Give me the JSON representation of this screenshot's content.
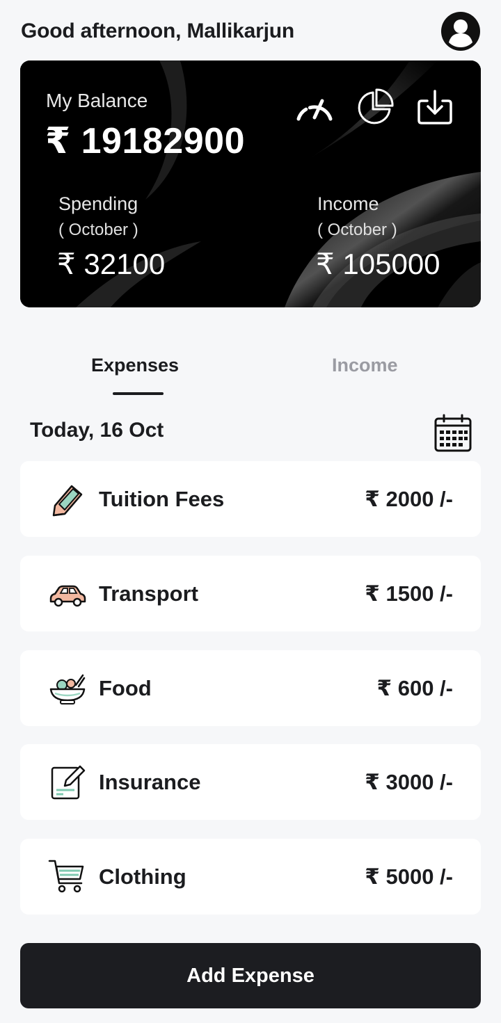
{
  "header": {
    "greeting": "Good afternoon, Mallikarjun",
    "avatar_icon": "user-avatar-icon"
  },
  "balance_card": {
    "balance_label": "My Balance",
    "balance_value": "₹ 19182900",
    "spending_label": "Spending",
    "spending_period": "( October )",
    "spending_value": "₹ 32100",
    "income_label": "Income",
    "income_period": "( October )",
    "income_value": "₹ 105000",
    "action_icons": [
      "speedometer-icon",
      "pie-chart-icon",
      "download-icon"
    ]
  },
  "tabs": [
    {
      "label": "Expenses",
      "active": true
    },
    {
      "label": "Income",
      "active": false
    }
  ],
  "date_header": {
    "label": "Today, 16 Oct",
    "calendar_icon": "calendar-icon"
  },
  "expenses": [
    {
      "name": "Tuition Fees",
      "amount": "₹ 2000 /-",
      "icon": "pencil-icon"
    },
    {
      "name": "Transport",
      "amount": "₹ 1500 /-",
      "icon": "car-icon"
    },
    {
      "name": "Food",
      "amount": "₹ 600 /-",
      "icon": "food-bowl-icon"
    },
    {
      "name": "Insurance",
      "amount": "₹ 3000 /-",
      "icon": "document-edit-icon"
    },
    {
      "name": "Clothing",
      "amount": "₹ 5000 /-",
      "icon": "shopping-cart-icon"
    }
  ],
  "footer": {
    "add_button_label": "Add Expense"
  },
  "colors": {
    "background": "#f6f7f9",
    "card": "#000000",
    "text": "#1b1c1f",
    "muted": "#9a9ba2",
    "accent_green": "#7fc9b0",
    "accent_peach": "#f2b8a0",
    "button": "#1c1d21"
  }
}
